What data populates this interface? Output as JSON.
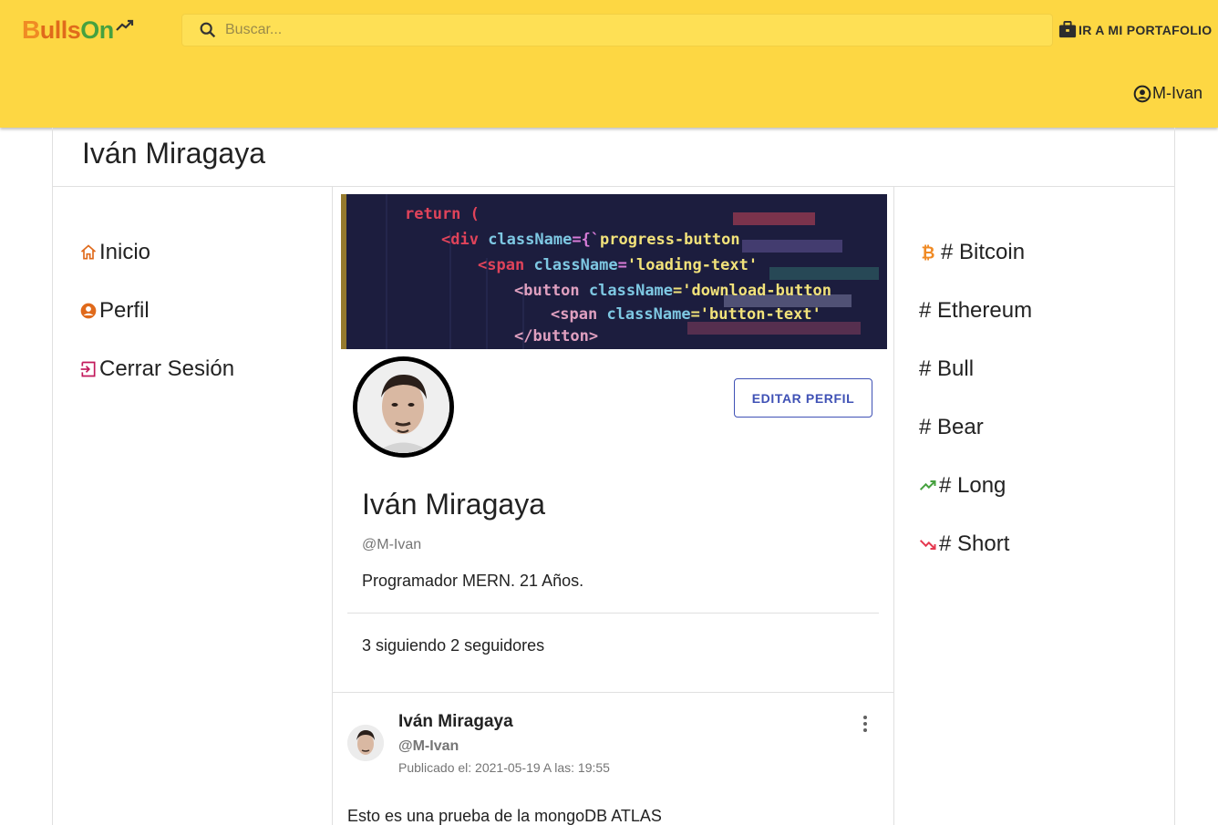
{
  "brand": {
    "logo_b": "B",
    "logo_ulls": "ulls",
    "logo_on": "On"
  },
  "search": {
    "placeholder": "Buscar..."
  },
  "header": {
    "portfolio_label": "IR A MI PORTAFOLIO",
    "user_label": "M-Ivan"
  },
  "page": {
    "title": "Iván Miragaya"
  },
  "leftnav": {
    "items": [
      {
        "label": "Inicio",
        "icon": "home-icon"
      },
      {
        "label": "Perfil",
        "icon": "account-circle-icon"
      },
      {
        "label": "Cerrar Sesión",
        "icon": "logout-icon"
      }
    ]
  },
  "profile": {
    "edit_button": "EDITAR PERFIL",
    "name": "Iván Miragaya",
    "handle": "@M-Ivan",
    "bio": "Programador MERN. 21 Años.",
    "following": "3 siguiendo",
    "followers": "2 seguidores"
  },
  "post": {
    "author": "Iván Miragaya",
    "handle": "@M-Ivan",
    "date": "Publicado el: 2021-05-19 A las: 19:55",
    "text": "Esto es una prueba de la mongoDB ATLAS"
  },
  "tags": {
    "items": [
      {
        "label": "# Bitcoin",
        "icon": "bitcoin-icon"
      },
      {
        "label": "# Ethereum"
      },
      {
        "label": "# Bull"
      },
      {
        "label": "# Bear"
      },
      {
        "label": "# Long",
        "icon": "trending-up-icon"
      },
      {
        "label": "# Short",
        "icon": "trending-down-icon"
      }
    ]
  },
  "colors": {
    "appbar": "#fdd743",
    "accent": "#3f51b5",
    "orange": "#f08a24",
    "green": "#46a13f",
    "red": "#e53950"
  }
}
